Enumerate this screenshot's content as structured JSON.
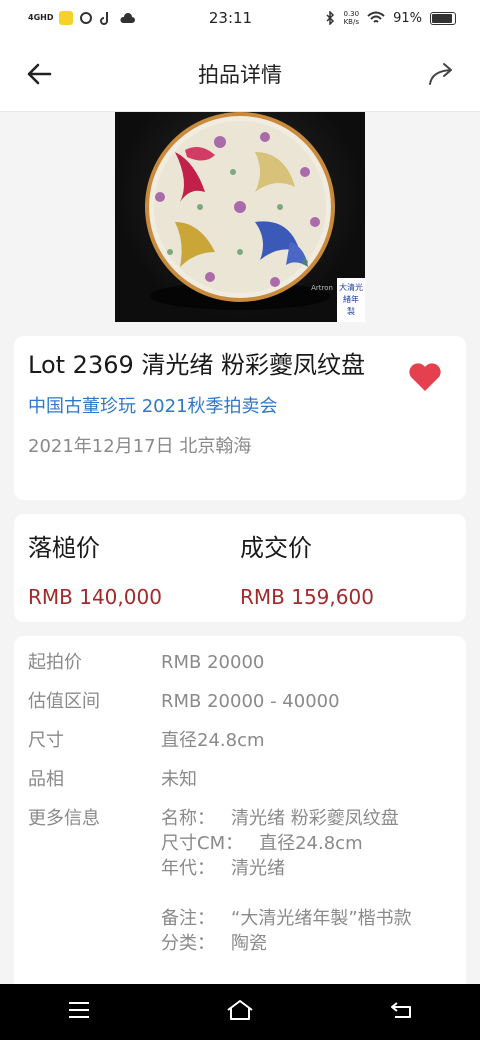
{
  "status_bar": {
    "network": "4GHD",
    "time": "23:11",
    "speed_value": "0.30",
    "speed_unit": "KB/s",
    "battery": "91%",
    "battery_level": 0.91
  },
  "header": {
    "title": "拍品详情",
    "back_icon": "arrow-left-icon",
    "share_icon": "share-icon"
  },
  "lot": {
    "title": "Lot 2369 清光绪 粉彩夔凤纹盘",
    "auction": "中国古董珍玩 2021秋季拍卖会",
    "date_place": "2021年12月17日 北京翰海",
    "favorited": true,
    "image_watermark": "Artron",
    "image_seal": "大清光緒年製"
  },
  "prices": {
    "hammer_label": "落槌价",
    "hammer_value": "RMB 140,000",
    "final_label": "成交价",
    "final_value": "RMB 159,600"
  },
  "details": {
    "rows": [
      {
        "label": "起拍价",
        "value": "RMB 20000"
      },
      {
        "label": "估值区间",
        "value": "RMB 20000 - 40000"
      },
      {
        "label": "尺寸",
        "value": "直径24.8cm"
      },
      {
        "label": "品相",
        "value": "未知"
      }
    ],
    "more_label": "更多信息",
    "more_info": [
      {
        "key": "名称：",
        "value": "清光绪 粉彩夔凤纹盘"
      },
      {
        "key": "尺寸CM：",
        "value": "直径24.8cm"
      },
      {
        "key": "年代：",
        "value": "清光绪"
      },
      {
        "key": "备注：",
        "value": "“大清光绪年製”楷书款"
      },
      {
        "key": "分类：",
        "value": "陶瓷"
      }
    ]
  },
  "colors": {
    "accent_link": "#2f78c9",
    "price_red": "#a32a2a",
    "heart_red": "#e5404e"
  }
}
